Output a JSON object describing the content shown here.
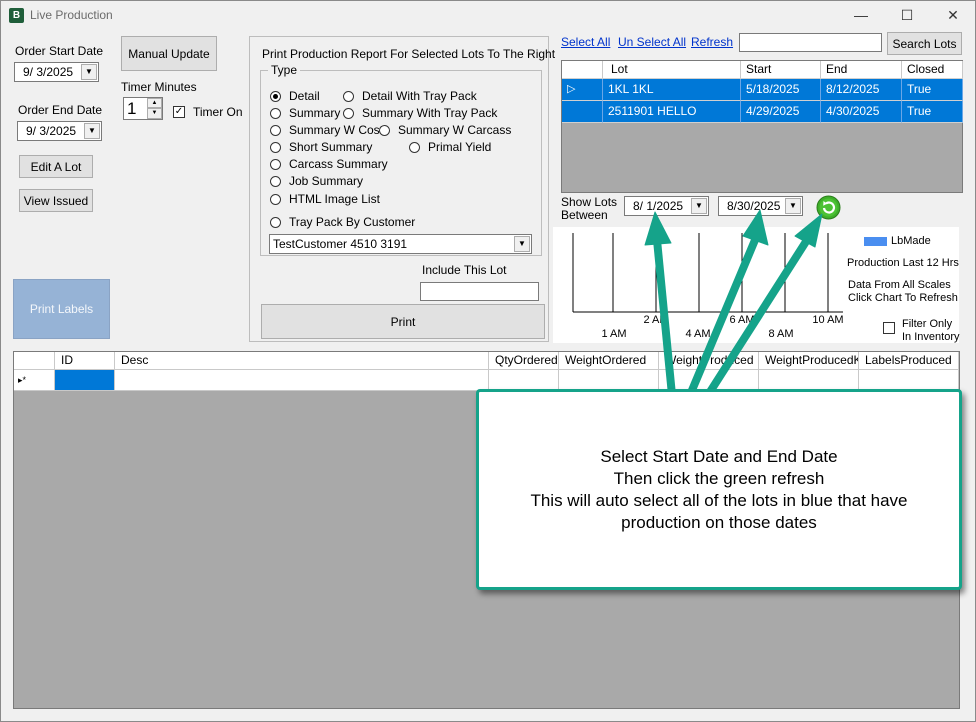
{
  "window": {
    "title": "Live Production",
    "icon": "app-logo-icon",
    "controls": {
      "minimize": "—",
      "maximize": "☐",
      "close": "✕"
    }
  },
  "left": {
    "order_start_label": "Order Start Date",
    "order_start_value": "9/  3/2025",
    "order_end_label": "Order End Date",
    "order_end_value": "9/  3/2025",
    "edit_lot": "Edit A Lot",
    "view_issued": "View Issued",
    "print_labels": "Print Labels",
    "manual_update": "Manual Update",
    "timer_minutes_label": "Timer Minutes",
    "timer_minutes_value": "1",
    "timer_on_label": "Timer On",
    "timer_on_checked": "✓"
  },
  "report": {
    "title": "Print Production Report For Selected Lots To The Right",
    "type_label": "Type",
    "options": {
      "detail": "Detail",
      "detail_tray": "Detail With Tray Pack",
      "summary": "Summary",
      "summary_tray": "Summary With Tray Pack",
      "summary_cost": "Summary  W Cost",
      "summary_carcass": "Summary  W Carcass",
      "short_summary": "Short Summary",
      "primal_yield": "Primal Yield",
      "carcass_summary": "Carcass Summary",
      "job_summary": "Job Summary",
      "html_image_list": "HTML Image List",
      "tray_pack_customer": "Tray Pack By Customer"
    },
    "customer_value": "TestCustomer 4510 3191",
    "include_lot_label": "Include This Lot",
    "include_lot_value": "",
    "print": "Print"
  },
  "lots": {
    "select_all": "Select All",
    "unselect_all": "Un Select All",
    "refresh": "Refresh",
    "search_value": "",
    "search_button": "Search Lots",
    "columns": [
      "Lot",
      "Start",
      "End",
      "Closed"
    ],
    "rows": [
      {
        "lot": "1KL 1KL",
        "start": "5/18/2025",
        "end": "8/12/2025",
        "closed": "True",
        "marker": "▷"
      },
      {
        "lot": "2511901 HELLO",
        "start": "4/29/2025",
        "end": "4/30/2025",
        "closed": "True",
        "marker": ""
      }
    ],
    "show_lots_label_1": "Show Lots",
    "show_lots_label_2": "Between",
    "from_date": "8/  1/2025",
    "to_date": "8/30/2025",
    "refresh_icon": "green-refresh-icon"
  },
  "chart_data": {
    "type": "bar",
    "x_ticks_upper": [
      "2 AM",
      "6 AM",
      "10 AM"
    ],
    "x_ticks_lower": [
      "1 AM",
      "4 AM",
      "8 AM"
    ],
    "series": [
      {
        "name": "LbMade",
        "values": [],
        "color": "#4a8ef0"
      }
    ],
    "legend_label": "LbMade",
    "note_1": "Production Last 12 Hrs",
    "note_2a": "Data From All Scales",
    "note_2b": "Click Chart To Refresh",
    "filter_label_1": "Filter Only",
    "filter_label_2": "In Inventory"
  },
  "grid": {
    "columns": [
      "ID",
      "Desc",
      "QtyOrdered",
      "WeightOrdered",
      "WeightProduced",
      "WeightProducedKg",
      "LabelsProduced"
    ],
    "new_row_marker": "▸*"
  },
  "callout": {
    "line1": "Select Start Date and End Date",
    "line2": "Then click the green refresh",
    "line3": "This will auto select all of the lots in blue that have",
    "line4": "production on those dates"
  },
  "colors": {
    "selection": "#0078d7",
    "callout_border": "#15a38a",
    "print_labels_bg": "#96b3d6",
    "grid_bg": "#a9a9a9"
  }
}
